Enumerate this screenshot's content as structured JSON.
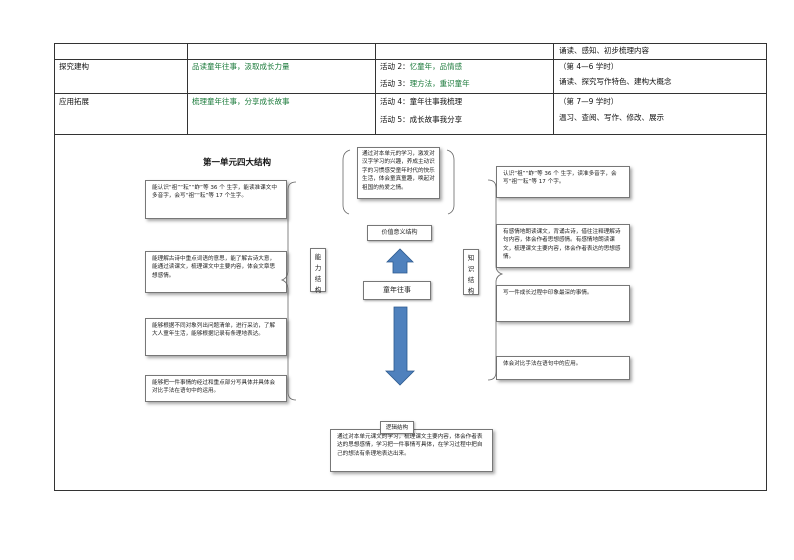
{
  "table": {
    "row0": {
      "col4": "诵读、感知、初步梳理内容"
    },
    "row1": {
      "col1": "探究建构",
      "col2": "品读童年往事，汲取成长力量",
      "act2_prefix": "活动 2：",
      "act2_text": "忆童年，品情感",
      "act3_prefix": "活动 3：",
      "act3_text": "理方法，重识童年",
      "period": "（第 4—6 学时）",
      "desc": "诵读、探究写作特色、建构大概念"
    },
    "row2": {
      "col1": "应用拓展",
      "col2": "梳理童年往事，分享成长故事",
      "act4": "活动 4：童年往事我梳理",
      "act5": "活动 5：成长故事我分享",
      "period": "（第 7—9 学时）",
      "desc": "温习、查阅、写作、修改、展示"
    }
  },
  "diagram": {
    "title": "第一单元四大结构",
    "left_boxes": [
      "能认识“祖”“耘”“蚱”等 36 个 生字，能读准课文中多音字，会写“祖”“耘”等 17 个生字。",
      "能理解古诗中重点词语的意思，能了解古诗大意，能通过读课文，梳理课文中主要内容，体会文章思想感情。",
      "能够根据不同对象列出问题清单，进行采访，了解大人童年生活，能够根据记录有条理地表达。",
      "能够把一件事情的经过和重点部分写具体并具体会对比手法在语句中的运用。"
    ],
    "ability_label": "能力结构",
    "knowledge_label": "知识结构",
    "top_center_box": "通过对本单元的学习，激发对汉字学习的兴趣，养成主动识字的习惯感受童年时代的快乐生活，体会童真童趣，唤起对祖国的热爱之情。",
    "value_label": "价值意义结构",
    "center_label": "童年往事",
    "logic_label": "逻辑结构",
    "bottom_box": "通过对本单元课文的学习，梳理课文主要内容，体会作者表达的思想感情，学习把一件事情写具体，在学习过程中把自己的想法有条理地表达出来。",
    "right_boxes": [
      "认识“祖”“蚱”等 36 个 生字，读准多音字，会写“祖”“耘”等 17 个字。",
      "有感情地朗读课文，背诵古诗，借往注释理解诗句内容，体会作者思想感情。有感情地朗读课文，梳理课文主要内容，体会作者表达的思想感情。",
      "写一件成长过程中印象最深的事情。",
      "体会对比手法在语句中的应用。"
    ],
    "colors": {
      "arrow_fill": "#4f81bd",
      "arrow_stroke": "#2c5a8f",
      "green_text": "#1a7a3a",
      "box_border": "#777777"
    }
  }
}
